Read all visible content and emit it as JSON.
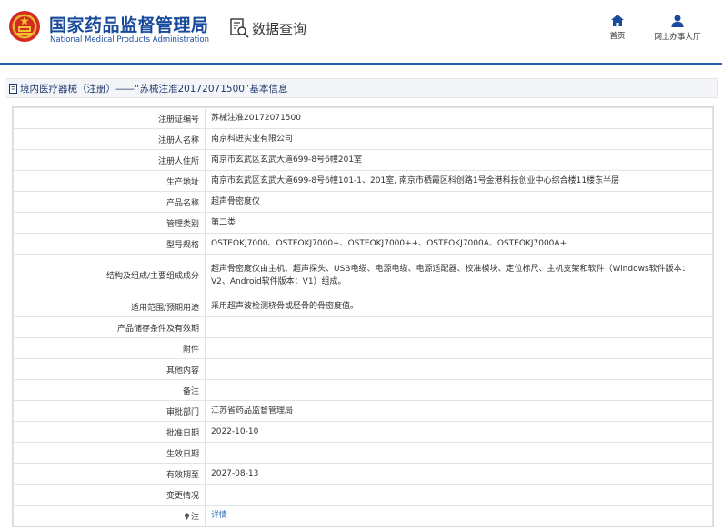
{
  "header": {
    "title_cn": "国家药品监督管理局",
    "title_en": "National Medical Products Administration",
    "query_label": "数据查询",
    "nav_home": "首页",
    "nav_hall": "网上办事大厅",
    "brand_color": "#1a4a9c"
  },
  "breadcrumb": {
    "text": "境内医疗器械（注册）——“苏械注准20172071500”基本信息"
  },
  "rows": [
    {
      "label": "注册证编号",
      "value": "苏械注准20172071500"
    },
    {
      "label": "注册人名称",
      "value": "南京科进实业有限公司"
    },
    {
      "label": "注册人住所",
      "value": "南京市玄武区玄武大道699-8号6幢201室"
    },
    {
      "label": "生产地址",
      "value": "南京市玄武区玄武大道699-8号6幢101-1、201室, 南京市栖霞区科创路1号金港科技创业中心综合楼11楼东半层"
    },
    {
      "label": "产品名称",
      "value": "超声骨密度仪"
    },
    {
      "label": "管理类别",
      "value": "第二类"
    },
    {
      "label": "型号规格",
      "value": "OSTEOKJ7000、OSTEOKJ7000+、OSTEOKJ7000++、OSTEOKJ7000A、OSTEOKJ7000A+"
    },
    {
      "label": "结构及组成/主要组成成分",
      "value": "超声骨密度仪由主机、超声探头、USB电缆、电源电缆、电源适配器、校准模块、定位标尺、主机支架和软件（Windows软件版本：V2、Android软件版本：V1）组成。"
    },
    {
      "label": "适用范围/预期用途",
      "value": "采用超声波检测桡骨或胫骨的骨密度值。"
    },
    {
      "label": "产品储存条件及有效期",
      "value": ""
    },
    {
      "label": "附件",
      "value": ""
    },
    {
      "label": "其他内容",
      "value": ""
    },
    {
      "label": "备注",
      "value": ""
    },
    {
      "label": "审批部门",
      "value": "江苏省药品监督管理局"
    },
    {
      "label": "批准日期",
      "value": "2022-10-10"
    },
    {
      "label": "生效日期",
      "value": ""
    },
    {
      "label": "有效期至",
      "value": "2027-08-13"
    },
    {
      "label": "变更情况",
      "value": ""
    }
  ],
  "note_row": {
    "label": "注",
    "link": "详情"
  }
}
